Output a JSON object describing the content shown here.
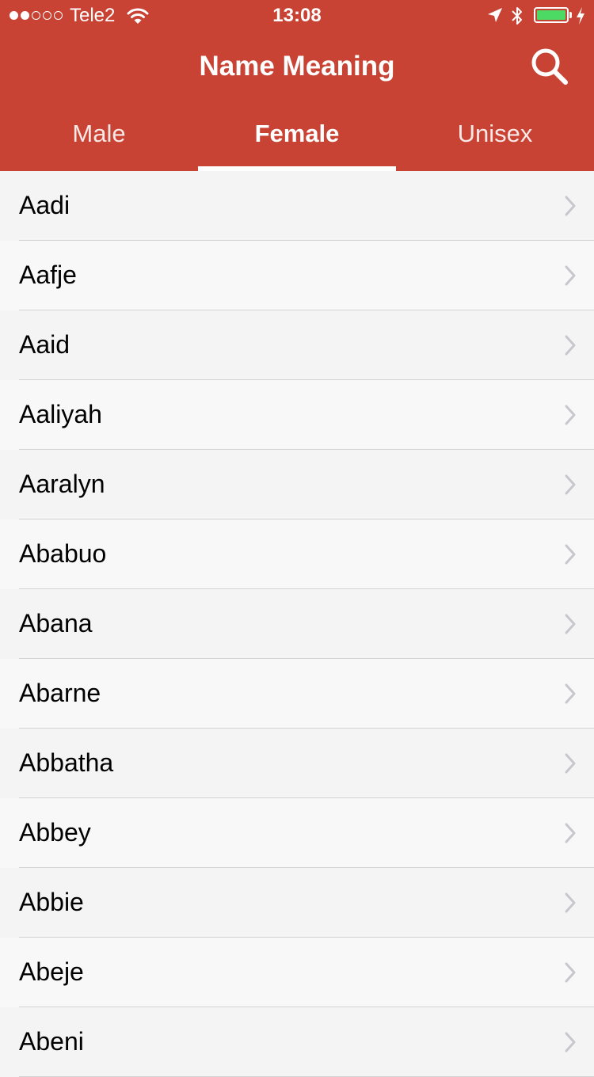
{
  "status_bar": {
    "carrier": "Tele2",
    "time": "13:08",
    "signal_bars_filled": 2,
    "signal_bars_total": 5,
    "battery_level": 1.0,
    "battery_color": "#4cd964"
  },
  "header": {
    "title": "Name Meaning",
    "search_icon": "search-icon",
    "background": "#c84334"
  },
  "tabs": [
    {
      "label": "Male",
      "active": false
    },
    {
      "label": "Female",
      "active": true
    },
    {
      "label": "Unisex",
      "active": false
    }
  ],
  "names": [
    "Aadi",
    "Aafje",
    "Aaid",
    "Aaliyah",
    "Aaralyn",
    "Ababuo",
    "Abana",
    "Abarne",
    "Abbatha",
    "Abbey",
    "Abbie",
    "Abeje",
    "Abeni"
  ]
}
